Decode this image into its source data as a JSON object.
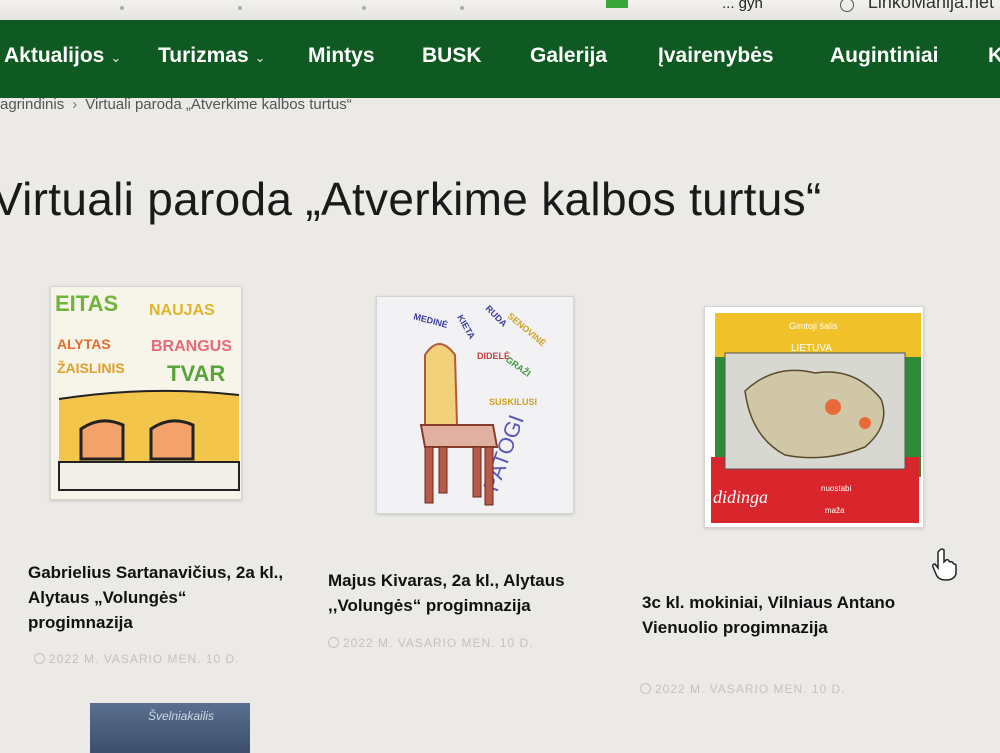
{
  "browser": {
    "site_label": "LinkoManija.net",
    "extension_text": "... gyn"
  },
  "nav": {
    "items": [
      {
        "label": "Aktualijos",
        "dropdown": true
      },
      {
        "label": "Turizmas",
        "dropdown": true
      },
      {
        "label": "Mintys",
        "dropdown": false
      },
      {
        "label": "BUSK",
        "dropdown": false
      },
      {
        "label": "Galerija",
        "dropdown": false
      },
      {
        "label": "Įvairenybės",
        "dropdown": false
      },
      {
        "label": "Augintiniai",
        "dropdown": false
      },
      {
        "label": "K",
        "dropdown": false
      }
    ],
    "chevron": "⌄"
  },
  "breadcrumb": {
    "home": "agrindinis",
    "separator": "›",
    "current": "Virtuali paroda „Atverkime kalbos turtus“"
  },
  "page_title": "Virtuali paroda „Atverkime kalbos turtus“",
  "gallery": {
    "items": [
      {
        "caption": "Gabrielius Sartanavičius, 2a kl., Alytaus „Volungės“ progimnazija",
        "date": "2022 M. VASARIO MEN. 10 D.",
        "art_words": [
          "EITAS",
          "NAUJAS",
          "ALYTAS",
          "BRANGUS",
          "ŽAISLINIS",
          "TVAR"
        ]
      },
      {
        "caption": "Majus Kivaras, 2a kl., Alytaus ,,Volungės“ progimnazija",
        "date": "2022 M. VASARIO MEN. 10 D.",
        "art_words": [
          "MEDINĖ",
          "KIETA",
          "RUDA",
          "SENOVINĖ",
          "DIDELĖ",
          "GRAŽI",
          "SUSKILUSI",
          "PATOGI"
        ]
      },
      {
        "caption": "3c kl. mokiniai, Vilniaus Antano Vienuolio progimnazija",
        "date": "2022 M. VASARIO MEN. 10 D.",
        "art_words": [
          "Gimtoji šalis",
          "LIETUVA",
          "didinga",
          "nuostabi",
          "maža"
        ]
      }
    ],
    "partial_item_text": "Švelniakailis"
  },
  "colors": {
    "nav_bg": "#0f5a22",
    "page_bg": "#eceae6"
  }
}
